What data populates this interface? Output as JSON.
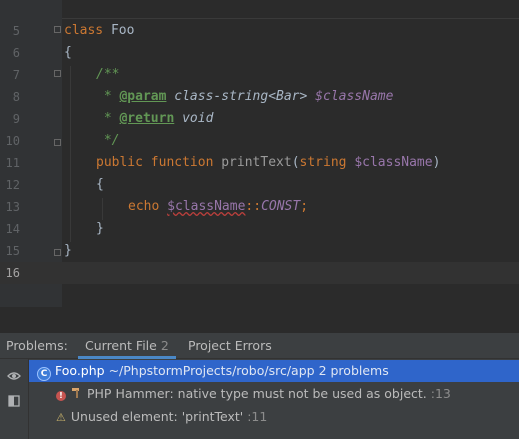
{
  "editor": {
    "lines": [
      {
        "num": "5",
        "t1": "class",
        "t2": " Foo"
      },
      {
        "num": "6",
        "t1": "{"
      },
      {
        "num": "7",
        "t1": "/**"
      },
      {
        "num": "8",
        "t1": " * ",
        "t2": "@param",
        "t3": " class-string<Bar> ",
        "t4": "$className"
      },
      {
        "num": "9",
        "t1": " * ",
        "t2": "@return",
        "t3": " void"
      },
      {
        "num": "10",
        "t1": " */"
      },
      {
        "num": "11",
        "t1": "public function ",
        "t2": "printText",
        "t3": "(",
        "t4": "string ",
        "t5": "$className",
        "t6": ")"
      },
      {
        "num": "12",
        "t1": "{"
      },
      {
        "num": "13",
        "t1": "echo ",
        "t2": "$className",
        "t3": "::",
        "t4": "CONST",
        "t5": ";"
      },
      {
        "num": "14",
        "t1": "}"
      },
      {
        "num": "15",
        "t1": "}"
      },
      {
        "num": "16",
        "t1": ""
      }
    ]
  },
  "problems": {
    "label": "Problems:",
    "tabs": [
      {
        "label": "Current File",
        "count": "2"
      },
      {
        "label": "Project Errors",
        "count": ""
      }
    ],
    "file_row": {
      "icon": "C",
      "filename": "Foo.php",
      "path": " ~/PhpstormProjects/robo/src/app",
      "summary": "  2 problems"
    },
    "items": [
      {
        "severity": "error",
        "icon": "!",
        "tool_icon": "hammer-icon",
        "message": "PHP Hammer: native type must not be used as object.",
        "line": " :13"
      },
      {
        "severity": "warning",
        "icon": "⚠",
        "message": "Unused element: 'printText'",
        "line": " :11"
      }
    ],
    "sidebar_icons": [
      "eye-icon",
      "preview-icon"
    ]
  },
  "colors": {
    "keyword": "#cc7832",
    "variable": "#9876aa",
    "doc": "#629755",
    "selection": "#2f65ca",
    "error": "#c75450",
    "warning": "#c9b36b"
  }
}
